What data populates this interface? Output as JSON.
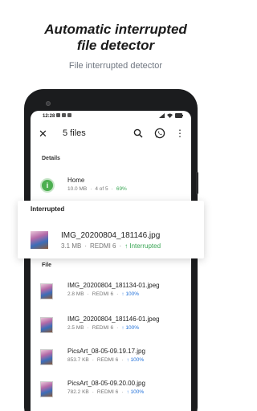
{
  "hero": {
    "title_line1": "Automatic interrupted",
    "title_line2": "file detector",
    "subtitle": "File interrupted detector"
  },
  "status": {
    "time": "12:28"
  },
  "appbar": {
    "title": "5 files",
    "close_icon": "close-icon",
    "search_icon": "search-icon",
    "whatsapp_icon": "whatsapp-icon",
    "more_icon": "more-vert-icon"
  },
  "details": {
    "label": "Details",
    "home": {
      "name": "Home",
      "size": "10.0 MB",
      "sep": "·",
      "progress": "4 of 5",
      "percent": "69%"
    }
  },
  "interrupted": {
    "label": "Interrupted",
    "file": {
      "name": "IMG_20200804_181146.jpg",
      "size": "3.1 MB",
      "device": "REDMI 6",
      "status": "↑ Interrupted"
    }
  },
  "file_section": {
    "label": "File",
    "items": [
      {
        "name": "IMG_20200804_181134-01.jpeg",
        "size": "2.8 MB",
        "device": "REDMI 6",
        "status": "↑ 100%"
      },
      {
        "name": "IMG_20200804_181146-01.jpeg",
        "size": "2.5 MB",
        "device": "REDMI 6",
        "status": "↑ 100%"
      },
      {
        "name": "PicsArt_08-05-09.19.17.jpg",
        "size": "853.7 KB",
        "device": "REDMI 6",
        "status": "↑ 100%"
      },
      {
        "name": "PicsArt_08-05-09.20.00.jpg",
        "size": "782.2 KB",
        "device": "REDMI 6",
        "status": "↑ 100%"
      }
    ]
  },
  "colors": {
    "accent_blue": "#1e6fd9",
    "accent_green": "#3aa655",
    "phone_body": "#1b1c1e"
  }
}
